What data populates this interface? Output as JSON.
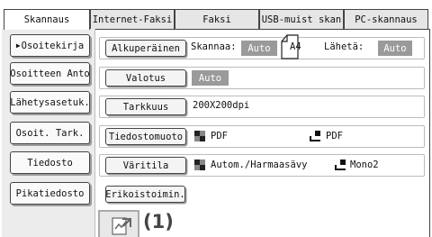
{
  "tabs": [
    "Skannaus",
    "Internet-Faksi",
    "Faksi",
    "USB-muist skan",
    "PC-skannaus"
  ],
  "left_buttons": [
    "Osoitekirja",
    "Osoitteen Anto",
    "Lähetysasetuk.",
    "Osoit. Tark.",
    "Tiedosto",
    "Pikatiedosto"
  ],
  "rows": {
    "original": {
      "button": "Alkuperäinen",
      "scan_label": "Skannaa:",
      "scan_value": "Auto",
      "size": "A4",
      "send_label": "Lähetä:",
      "send_value": "Auto"
    },
    "exposure": {
      "button": "Valotus",
      "value": "Auto"
    },
    "resolution": {
      "button": "Tarkkuus",
      "value": "200X200dpi"
    },
    "file_format": {
      "button": "Tiedostomuoto",
      "value_color": "PDF",
      "value_mono": "PDF"
    },
    "color_mode": {
      "button": "Väritila",
      "value_color": "Autom./Harmaasävy",
      "value_mono": "Mono2"
    },
    "special": {
      "button": "Erikoistoimin."
    }
  },
  "callout": {
    "label": "(1)"
  },
  "colors": {
    "badge": "#9a9a9a",
    "border": "#444444",
    "panel_bg": "#ececec"
  }
}
